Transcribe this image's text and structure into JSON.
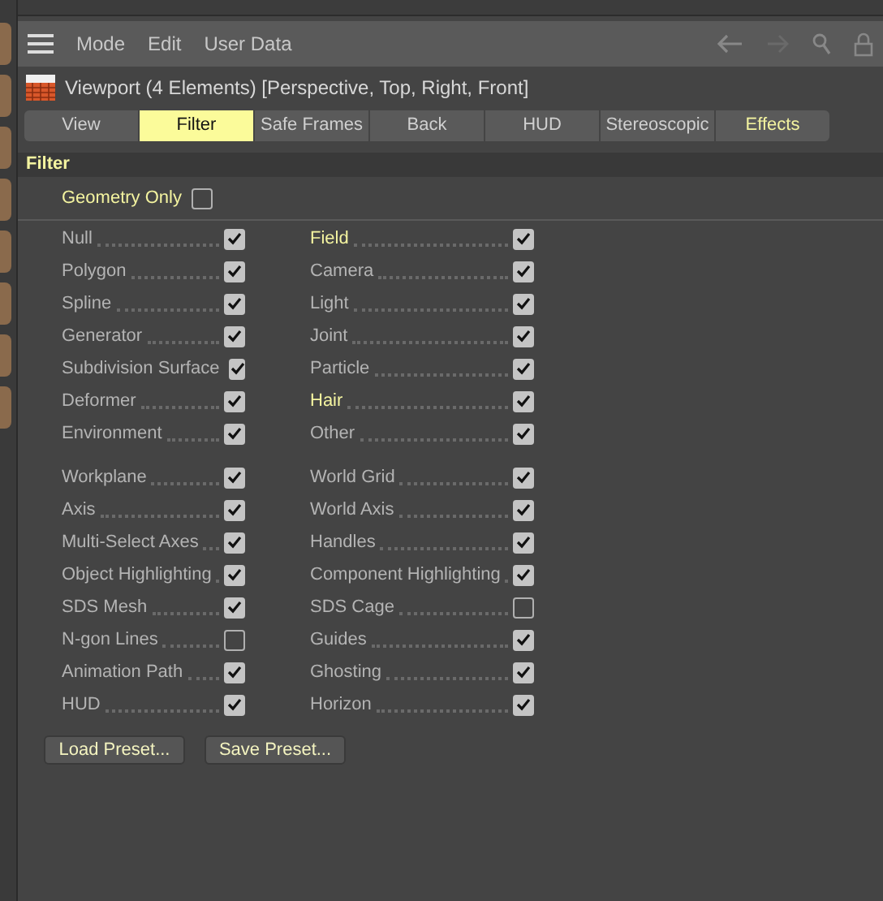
{
  "menu": [
    "Mode",
    "Edit",
    "User Data"
  ],
  "title": "Viewport (4 Elements) [Perspective, Top, Right, Front]",
  "tabs": [
    {
      "label": "View",
      "selected": false,
      "highlighted": false
    },
    {
      "label": "Filter",
      "selected": true,
      "highlighted": false
    },
    {
      "label": "Safe Frames",
      "selected": false,
      "highlighted": false
    },
    {
      "label": "Back",
      "selected": false,
      "highlighted": false
    },
    {
      "label": "HUD",
      "selected": false,
      "highlighted": false
    },
    {
      "label": "Stereoscopic",
      "selected": false,
      "highlighted": false
    },
    {
      "label": "Effects",
      "selected": false,
      "highlighted": true
    }
  ],
  "section": "Filter",
  "geometry_only": {
    "label": "Geometry Only",
    "checked": false
  },
  "groups": [
    {
      "left": [
        {
          "label": "Null",
          "checked": true,
          "highlighted": false
        },
        {
          "label": "Polygon",
          "checked": true,
          "highlighted": false
        },
        {
          "label": "Spline",
          "checked": true,
          "highlighted": false
        },
        {
          "label": "Generator",
          "checked": true,
          "highlighted": false
        },
        {
          "label": "Subdivision Surface",
          "checked": true,
          "highlighted": false
        },
        {
          "label": "Deformer",
          "checked": true,
          "highlighted": false
        },
        {
          "label": "Environment",
          "checked": true,
          "highlighted": false
        }
      ],
      "right": [
        {
          "label": "Field",
          "checked": true,
          "highlighted": true
        },
        {
          "label": "Camera",
          "checked": true,
          "highlighted": false
        },
        {
          "label": "Light",
          "checked": true,
          "highlighted": false
        },
        {
          "label": "Joint",
          "checked": true,
          "highlighted": false
        },
        {
          "label": "Particle",
          "checked": true,
          "highlighted": false
        },
        {
          "label": "Hair",
          "checked": true,
          "highlighted": true
        },
        {
          "label": "Other",
          "checked": true,
          "highlighted": false
        }
      ]
    },
    {
      "left": [
        {
          "label": "Workplane",
          "checked": true,
          "highlighted": false
        },
        {
          "label": "Axis",
          "checked": true,
          "highlighted": false
        },
        {
          "label": "Multi-Select Axes",
          "checked": true,
          "highlighted": false
        },
        {
          "label": "Object Highlighting",
          "checked": true,
          "highlighted": false
        },
        {
          "label": "SDS Mesh",
          "checked": true,
          "highlighted": false
        },
        {
          "label": "N-gon Lines",
          "checked": false,
          "highlighted": false
        },
        {
          "label": "Animation Path",
          "checked": true,
          "highlighted": false
        },
        {
          "label": "HUD",
          "checked": true,
          "highlighted": false
        }
      ],
      "right": [
        {
          "label": "World Grid",
          "checked": true,
          "highlighted": false
        },
        {
          "label": "World Axis",
          "checked": true,
          "highlighted": false
        },
        {
          "label": "Handles",
          "checked": true,
          "highlighted": false
        },
        {
          "label": "Component Highlighting",
          "checked": true,
          "highlighted": false
        },
        {
          "label": "SDS Cage",
          "checked": false,
          "highlighted": false
        },
        {
          "label": "Guides",
          "checked": true,
          "highlighted": false
        },
        {
          "label": "Ghosting",
          "checked": true,
          "highlighted": false
        },
        {
          "label": "Horizon",
          "checked": true,
          "highlighted": false
        }
      ]
    }
  ],
  "buttons": [
    "Load Preset...",
    "Save Preset..."
  ]
}
